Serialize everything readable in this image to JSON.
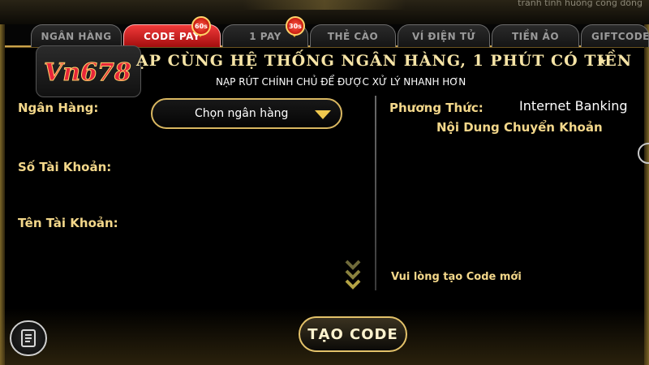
{
  "top_hint": "tranh tình huống công đồng",
  "tabs": [
    {
      "label": "NGÂN HÀNG",
      "active": false
    },
    {
      "label": "CODE PAY",
      "active": true,
      "badge": "60s"
    },
    {
      "label": "1 PAY",
      "active": false,
      "badge": "30s"
    },
    {
      "label": "THẺ CÀO",
      "active": false
    },
    {
      "label": "VÍ ĐIỆN TỬ",
      "active": false
    },
    {
      "label": "TIỀN ẢO",
      "active": false
    },
    {
      "label": "GIFTCODE",
      "active": false
    }
  ],
  "logo": {
    "text": "Vn678"
  },
  "headline": "ẠP CÙNG HỆ THỐNG NGÂN HÀNG, 1 PHÚT CÓ TIỀN",
  "headline_star": "★",
  "subline": "NẠP RÚT CHÍNH CHỦ ĐỂ ĐƯỢC XỬ LÝ NHANH HƠN",
  "form": {
    "bank_label": "Ngân Hàng:",
    "bank_select": "Chọn ngân hàng",
    "account_number_label": "Số Tài Khoản:",
    "account_name_label": "Tên Tài Khoản:"
  },
  "method": {
    "label": "Phương Thức:",
    "value": "Internet Banking",
    "content_title": "Nội Dung Chuyển Khoản",
    "note": "Vui lòng tạo Code mới"
  },
  "create_button": "TẠO CODE",
  "icons": {
    "history": "receipt-icon",
    "select_caret": "caret-down-icon",
    "scroll": "double-chevron-down-icon"
  },
  "colors": {
    "gold": "#f3d78a",
    "active_tab": "#d81f1f",
    "border_gold": "#d9b761"
  }
}
